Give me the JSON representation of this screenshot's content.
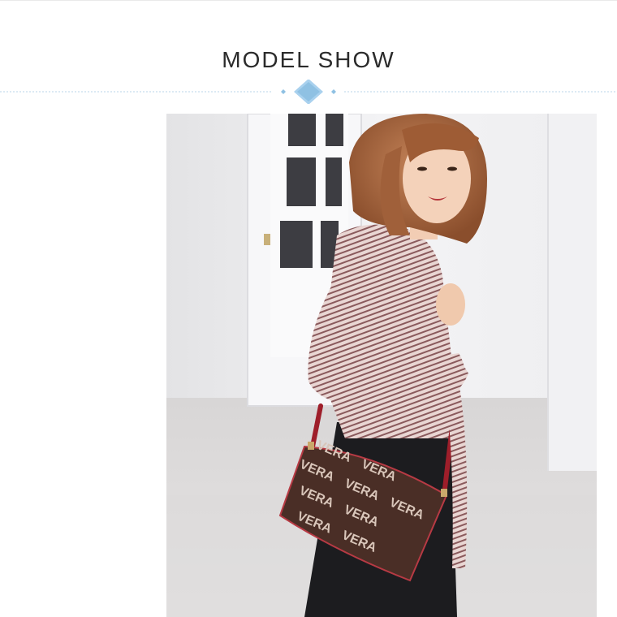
{
  "header": {
    "title": "MODEL SHOW"
  },
  "ornament": {
    "diamond_color": "#8fc1e3",
    "line_color": "#b9d6ea"
  },
  "photo": {
    "subject": "model-with-crossbody-bag",
    "bag_print": "VERA"
  }
}
